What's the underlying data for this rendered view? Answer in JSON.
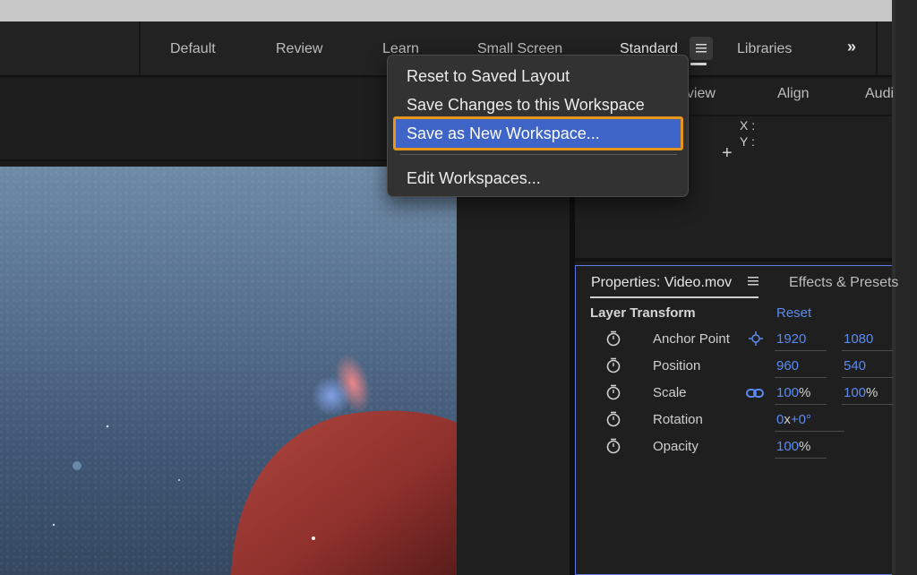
{
  "workspaces": {
    "tabs": [
      "Default",
      "Review",
      "Learn",
      "Small Screen",
      "Standard",
      "Libraries"
    ],
    "active": "Standard",
    "more_label": "»"
  },
  "menu": {
    "items": [
      "Reset to Saved Layout",
      "Save Changes to this Workspace",
      "Save as New Workspace...",
      "Edit Workspaces..."
    ],
    "selected": "Save as New Workspace..."
  },
  "info_panel": {
    "tabs": [
      "eview",
      "Align",
      "Audi"
    ],
    "x_label": "X :",
    "y_label": "Y :"
  },
  "properties": {
    "tab_title": "Properties: Video.mov",
    "other_tab": "Effects & Presets",
    "section": "Layer Transform",
    "reset_label": "Reset",
    "rows": [
      {
        "label": "Anchor Point",
        "v1": "1920",
        "v2": "1080",
        "u1": "",
        "u2": ""
      },
      {
        "label": "Position",
        "v1": "960",
        "v2": "540",
        "u1": "",
        "u2": ""
      },
      {
        "label": "Scale",
        "v1": "100",
        "v2": "100",
        "u1": "%",
        "u2": "%"
      },
      {
        "label": "Rotation",
        "v1": "0",
        "v2": "+0°",
        "u1": "x",
        "u2": ""
      },
      {
        "label": "Opacity",
        "v1": "100",
        "v2": "",
        "u1": "%",
        "u2": ""
      }
    ]
  },
  "colors": {
    "accent_blue": "#5b8bf0",
    "selection": "#3e64c7",
    "focus_ring": "#e8961a"
  }
}
